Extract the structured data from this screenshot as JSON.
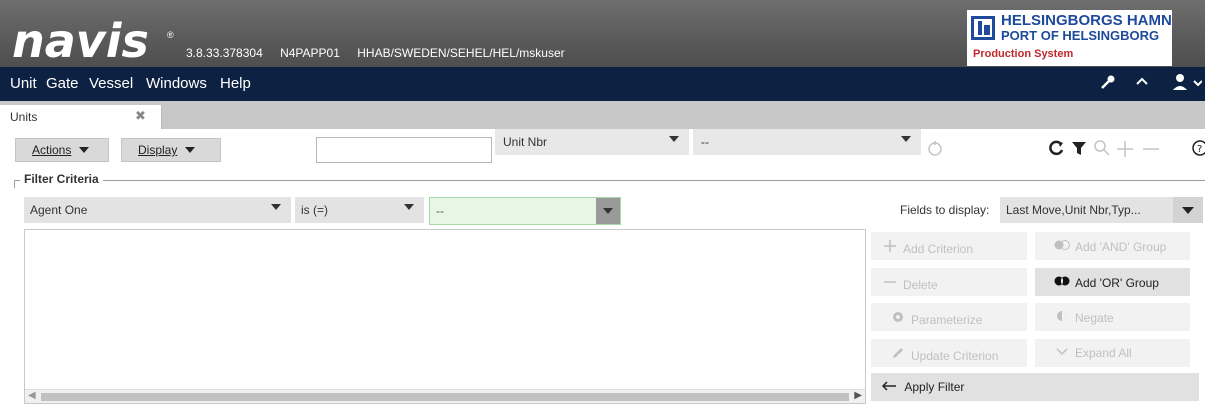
{
  "header": {
    "logo_text": "navis",
    "version": "3.8.33.378304",
    "server": "N4PAPP01",
    "scope": "HHAB/SWEDEN/SEHEL/HEL/mskuser",
    "port_logo": {
      "line1": "HELSINGBORGS HAMN",
      "line2": "PORT OF HELSINGBORG",
      "line3": "Production System"
    }
  },
  "menu": {
    "items": [
      {
        "label": "Unit"
      },
      {
        "label": "Gate"
      },
      {
        "label": "Vessel"
      },
      {
        "label": "Windows"
      },
      {
        "label": "Help"
      }
    ],
    "icons": [
      "wrench-icon",
      "chevron-up-icon",
      "user-icon"
    ]
  },
  "tabs": [
    {
      "label": "Units",
      "close": "✖"
    }
  ],
  "toolbar": {
    "actions_label": "Actions",
    "display_label": "Display",
    "search_value": "",
    "field_select": "Unit Nbr",
    "value_select": "--",
    "icons": [
      "reset-icon",
      "refresh-icon",
      "filter-icon",
      "search-icon",
      "plus-icon",
      "minus-icon",
      "help-icon"
    ]
  },
  "filter": {
    "title": "Filter Criteria",
    "field": "Agent One",
    "operator": "is (=)",
    "value": "--",
    "fields_to_display_label": "Fields to display:",
    "fields_to_display_value": "Last Move,Unit Nbr,Typ...",
    "buttons": {
      "add_criterion": "Add Criterion",
      "add_and_group": "Add 'AND' Group",
      "delete": "Delete",
      "add_or_group": "Add 'OR' Group",
      "parameterize": "Parameterize",
      "negate": "Negate",
      "update_criterion": "Update Criterion",
      "expand_all": "Expand All",
      "apply_filter": "Apply Filter"
    }
  }
}
